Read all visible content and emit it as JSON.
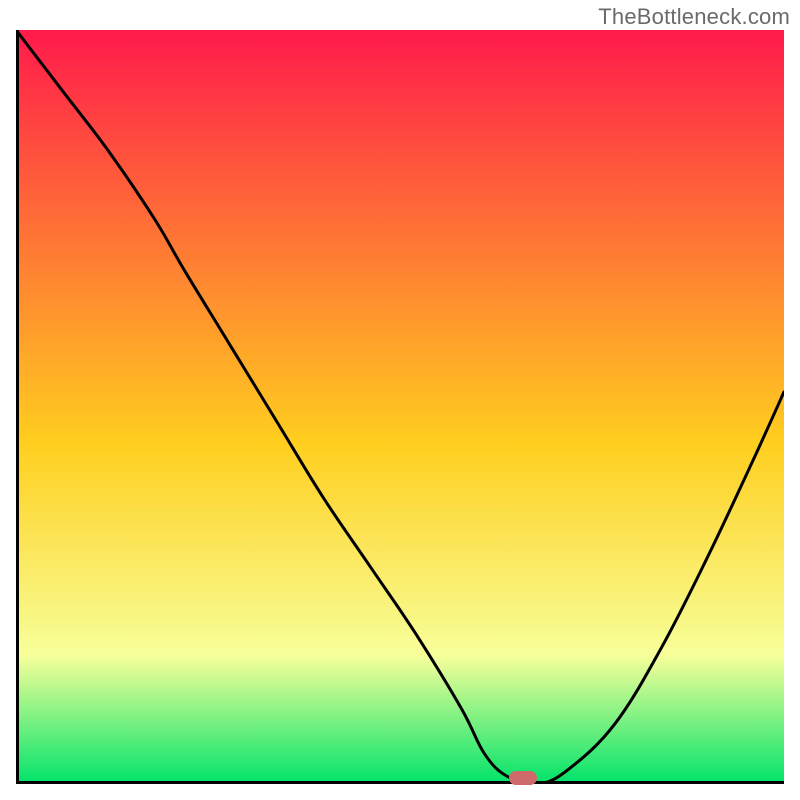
{
  "watermark": "TheBottleneck.com",
  "colors": {
    "grad_top": "#ff1a4b",
    "grad_mid": "#ffcf1f",
    "grad_low": "#f7ff9a",
    "grad_bottom": "#00e36a",
    "axis": "#000000",
    "curve": "#000000",
    "marker": "#cf6a6a"
  },
  "chart_data": {
    "type": "line",
    "title": "",
    "xlabel": "",
    "ylabel": "",
    "xlim": [
      0,
      100
    ],
    "ylim": [
      0,
      100
    ],
    "grid": false,
    "legend": false,
    "annotations": [
      {
        "type": "marker",
        "x": 66,
        "y": 0,
        "shape": "pill"
      }
    ],
    "series": [
      {
        "name": "bottleneck-curve",
        "x": [
          0,
          6,
          12,
          18,
          22,
          28,
          34,
          40,
          46,
          52,
          58,
          61,
          64,
          68,
          72,
          78,
          84,
          90,
          96,
          100
        ],
        "values": [
          100,
          92,
          84,
          75,
          68,
          58,
          48,
          38,
          29,
          20,
          10,
          4,
          1,
          0,
          2,
          8,
          18,
          30,
          43,
          52
        ]
      }
    ]
  }
}
